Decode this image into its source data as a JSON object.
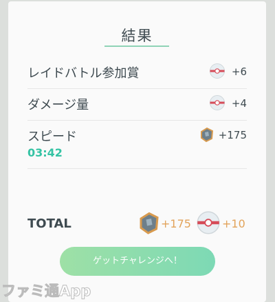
{
  "header": {
    "title": "結果"
  },
  "rows": [
    {
      "label": "レイドバトル参加賞",
      "amount": "+6",
      "icon": "premier-ball-icon"
    },
    {
      "label": "ダメージ量",
      "amount": "+4",
      "icon": "premier-ball-icon"
    },
    {
      "label": "スピード",
      "sub": "03:42",
      "amount": "+175",
      "icon": "rare-candy-stone-icon"
    }
  ],
  "total": {
    "label": "TOTAL",
    "stone_amount": "+175",
    "ball_amount": "+10"
  },
  "cta": {
    "label": "ゲットチャレンジへ！"
  },
  "watermark": {
    "text": "ファミ通App"
  },
  "colors": {
    "accent": "#35c3a4",
    "orange": "#e2a35a",
    "underline": "#8fd3b6"
  }
}
